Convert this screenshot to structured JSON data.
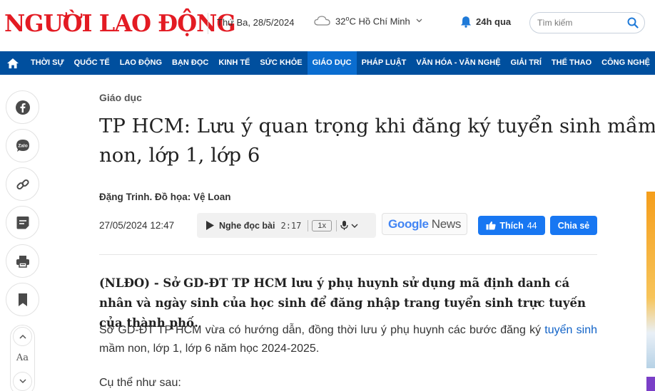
{
  "header": {
    "logo_text": "NGƯỜI LAO ĐỘNG",
    "date": "Thứ Ba, 28/5/2024",
    "weather": {
      "temp": "32",
      "unit": "C",
      "city": "Hồ Chí Minh",
      "icon": "cloud-icon"
    },
    "latest_label": "24h qua",
    "search_placeholder": "Tìm kiếm"
  },
  "nav": {
    "items": [
      {
        "label": "THỜI SỰ"
      },
      {
        "label": "QUỐC TẾ"
      },
      {
        "label": "LAO ĐỘNG"
      },
      {
        "label": "BẠN ĐỌC"
      },
      {
        "label": "KINH TẾ"
      },
      {
        "label": "SỨC KHỎE"
      },
      {
        "label": "GIÁO DỤC",
        "active": true
      },
      {
        "label": "PHÁP LUẬT"
      },
      {
        "label": "VĂN HÓA - VĂN NGHỆ"
      },
      {
        "label": "GIẢI TRÍ"
      },
      {
        "label": "THỂ THAO"
      },
      {
        "label": "CÔNG NGHỆ"
      }
    ]
  },
  "sidebar": {
    "buttons": [
      "facebook-icon",
      "zalo-icon",
      "link-icon",
      "comment-icon",
      "print-icon",
      "bookmark-icon"
    ],
    "zalo_text": "Zalo",
    "font_label": "Aa"
  },
  "article": {
    "category": "Giáo dục",
    "title": "TP HCM: Lưu ý quan trọng khi đăng ký tuyển sinh mầm non, lớp 1, lớp 6",
    "author": "Đặng Trinh. Đồ họa: Vệ Loan",
    "published": "27/05/2024 12:47",
    "audio": {
      "label": "Nghe đọc bài",
      "duration": "2:17",
      "speed": "1x"
    },
    "google_news": {
      "google": "Google",
      "news": "News"
    },
    "like": {
      "label": "Thích",
      "count": "44"
    },
    "share_label": "Chia sẻ",
    "sapo": "(NLĐO) - Sở GD-ĐT TP HCM lưu ý phụ huynh sử dụng mã định danh cá nhân và ngày sinh của học sinh để đăng nhập trang tuyển sinh trực tuyến của thành phố.",
    "para1_before": "Sở GD-ĐT TP HCM vừa có hướng dẫn, đồng thời lưu ý phụ huynh các bước đăng ký ",
    "para1_link": "tuyển sinh",
    "para1_after": " mầm non, lớp 1, lớp 6 năm học 2024-2025.",
    "para2": "Cụ thể như sau:"
  },
  "colors": {
    "brand_red": "#e31b23",
    "nav_blue": "#004f9e",
    "nav_active": "#0a6dd0",
    "fb_blue": "#1877f2",
    "link_blue": "#1062c7"
  }
}
